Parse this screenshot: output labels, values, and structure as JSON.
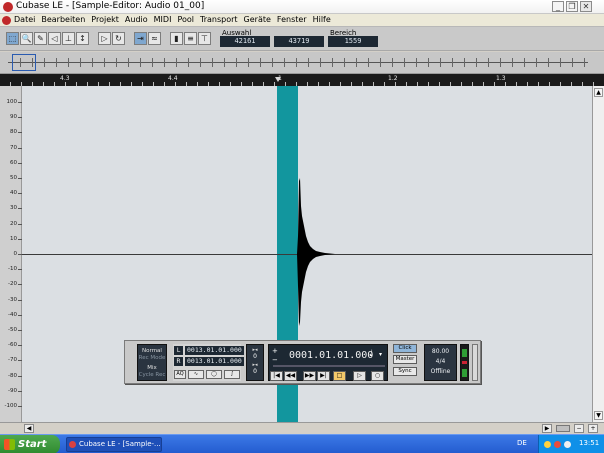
{
  "window": {
    "title": "Cubase LE - [Sample-Editor: Audio 01_00]",
    "controls": [
      "_",
      "❐",
      "✕"
    ]
  },
  "menu": {
    "items": [
      "Datei",
      "Bearbeiten",
      "Projekt",
      "Audio",
      "MIDI",
      "Pool",
      "Transport",
      "Geräte",
      "Fenster",
      "Hilfe"
    ]
  },
  "toolbar": {
    "auswahl_label": "Auswahl",
    "auswahl_start": "42161",
    "auswahl_end": "43719",
    "bereich_label": "Bereich",
    "bereich_value": "1559"
  },
  "ruler": {
    "labels": [
      "4.3",
      "4.4",
      "1",
      "1.2",
      "1.3"
    ]
  },
  "scale": {
    "labels": [
      "100",
      "90",
      "80",
      "70",
      "60",
      "50",
      "40",
      "30",
      "20",
      "10",
      "0",
      "-10",
      "-20",
      "-30",
      "-40",
      "-50",
      "-60",
      "-70",
      "-80",
      "-90",
      "-100"
    ]
  },
  "transport": {
    "mode_normal": "Normal",
    "rec_mode": "Rec Mode",
    "mix": "Mix",
    "cycle_rec": "Cycle Rec",
    "left_locator_letter": "L",
    "left_locator": "0013.01.01.000",
    "right_locator_letter": "R",
    "right_locator": "0013.01.01.000",
    "aq": "AQ",
    "pre_top": "0",
    "pre_bottom": "0",
    "position": "0001.01.01.000",
    "click": "Click",
    "master": "Master",
    "sync": "Sync",
    "tempo": "80.00",
    "signature": "4/4",
    "offline": "Offline"
  },
  "taskbar": {
    "start": "Start",
    "task": "Cubase LE - [Sample-...",
    "lang": "DE",
    "clock": "13:51"
  },
  "colors": {
    "selection": "#12969e",
    "wave": "#000000",
    "background": "#dbdfe3"
  }
}
